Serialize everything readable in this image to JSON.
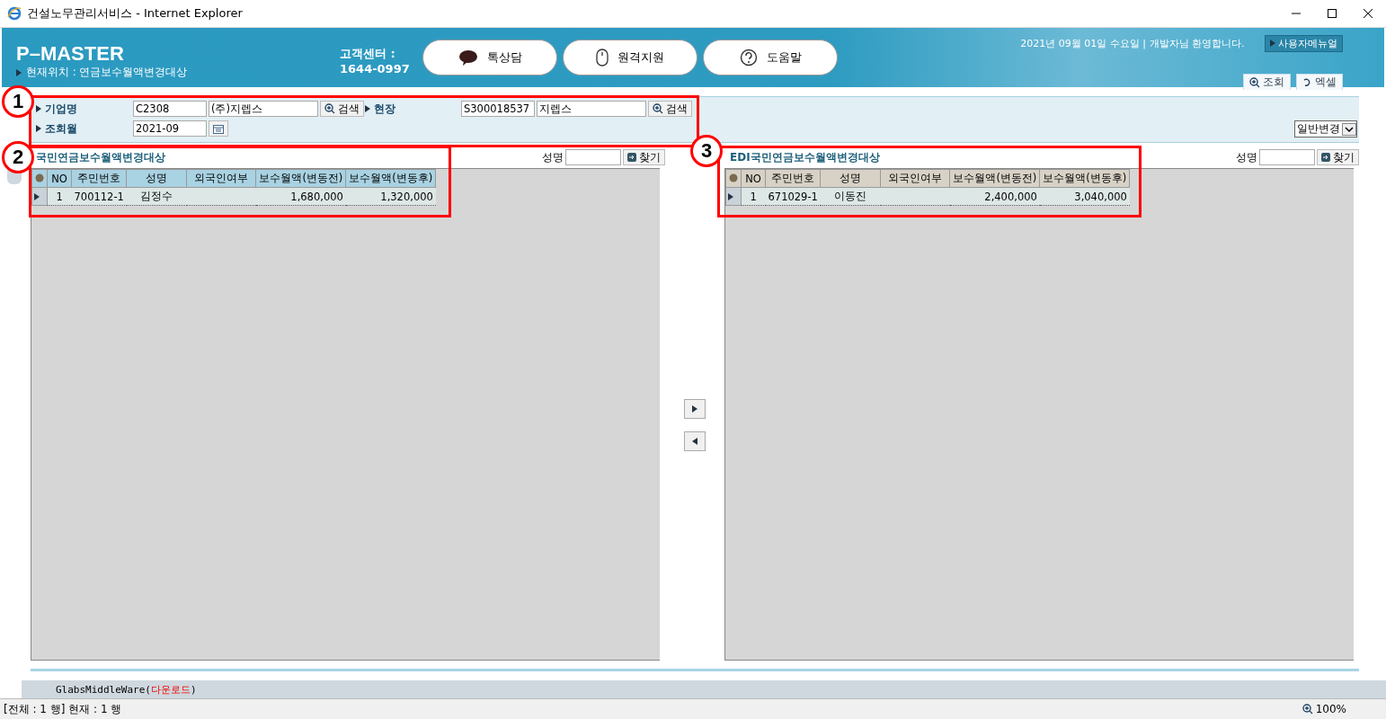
{
  "window": {
    "title": "건설노무관리서비스 - Internet Explorer"
  },
  "header": {
    "logo": "P–MASTER",
    "location": "현재위치 : 연금보수월액변경대상",
    "support_label": "고객센터 :",
    "support_phone": "1644-0997",
    "buttons": [
      {
        "kind": "chat",
        "label": "톡상담"
      },
      {
        "kind": "mouse",
        "label": "원격지원"
      },
      {
        "kind": "help",
        "label": "도움말"
      }
    ],
    "greeting": "2021년 09월 01일 수요일 | 개발자님 환영합니다.",
    "manual_button": "사용자메뉴얼",
    "actions": [
      {
        "kind": "search",
        "label": "조회"
      },
      {
        "kind": "excel",
        "label": "엑셀"
      }
    ]
  },
  "search": {
    "company_label": "기업명",
    "company_code": "C2308",
    "company_name": "(주)지렙스",
    "search_button": "검색",
    "site_label": "현장",
    "site_code": "S300018537",
    "site_name": "지렙스",
    "site_search_button": "검색",
    "month_label": "조회월",
    "month": "2021-09",
    "mode": "일반변경"
  },
  "panels": [
    {
      "title": "국민연금보수월액변경대상",
      "active": true,
      "name_label": "성명",
      "find_button": "찾기",
      "columns": [
        "NO",
        "주민번호",
        "성명",
        "외국인여부",
        "보수월액(변동전)",
        "보수월액(변동후)"
      ],
      "rows": [
        {
          "current": true,
          "cells": [
            "1",
            "700112-1",
            "김정수",
            "",
            "1,680,000",
            "1,320,000"
          ]
        }
      ]
    },
    {
      "title": "EDI국민연금보수월액변경대상",
      "active": false,
      "name_label": "성명",
      "find_button": "찾기",
      "columns": [
        "NO",
        "주민번호",
        "성명",
        "외국인여부",
        "보수월액(변동전)",
        "보수월액(변동후)"
      ],
      "rows": [
        {
          "current": true,
          "cells": [
            "1",
            "671029-1",
            "이동진",
            "",
            "2,400,000",
            "3,040,000"
          ]
        }
      ]
    }
  ],
  "callouts": [
    "1",
    "2",
    "3"
  ],
  "middleware": {
    "name": "GlabsMiddleWare(",
    "link": "다운로드",
    "suffix": ")"
  },
  "status_bar": {
    "rows": "[전체 : 1 행] 현재 : 1 행",
    "zoom": "100%"
  }
}
